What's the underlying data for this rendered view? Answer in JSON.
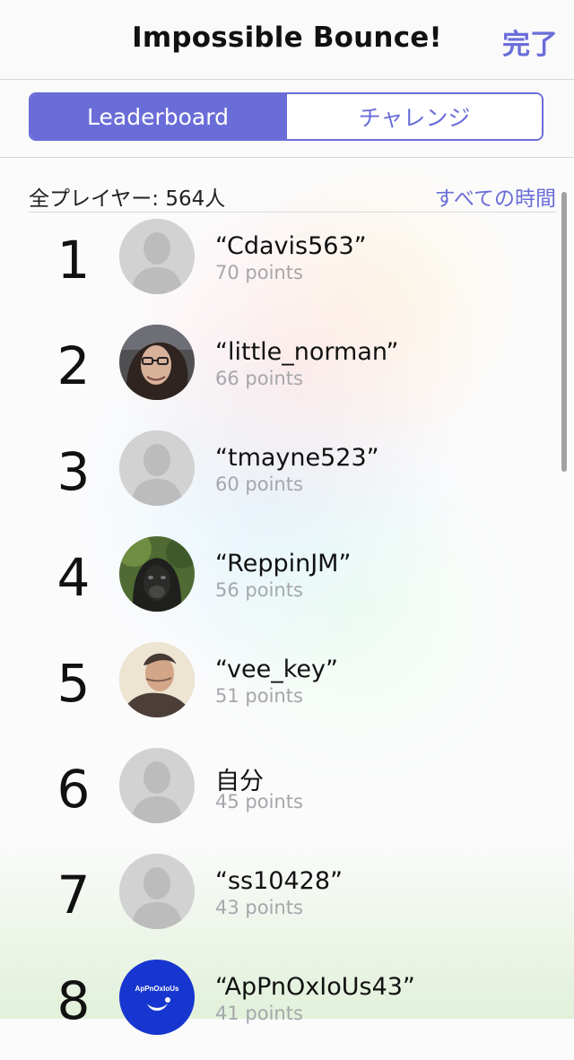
{
  "header": {
    "title": "Impossible Bounce!",
    "done_label": "完了"
  },
  "segmented": {
    "leaderboard_label": "Leaderboard",
    "challenge_label": "チャレンジ"
  },
  "summary": {
    "player_count_text": "全プレイヤー: 564人",
    "time_filter_label": "すべての時間"
  },
  "rows": [
    {
      "rank": "1",
      "name": "“Cdavis563”",
      "points": "70 points",
      "avatar": "default-avatar-icon"
    },
    {
      "rank": "2",
      "name": "“little_norman”",
      "points": "66 points",
      "avatar": "profile-photo-little-norman"
    },
    {
      "rank": "3",
      "name": "“tmayne523”",
      "points": "60 points",
      "avatar": "default-avatar-icon"
    },
    {
      "rank": "4",
      "name": "“ReppinJM”",
      "points": "56 points",
      "avatar": "profile-photo-reppinjm"
    },
    {
      "rank": "5",
      "name": "“vee_key”",
      "points": "51 points",
      "avatar": "profile-photo-vee-key"
    },
    {
      "rank": "6",
      "name": "自分",
      "points": "45 points",
      "avatar": "default-avatar-icon"
    },
    {
      "rank": "7",
      "name": "“ss10428”",
      "points": "43 points",
      "avatar": "default-avatar-icon"
    },
    {
      "rank": "8",
      "name": "“ApPnOxIoUs43”",
      "points": "41 points",
      "avatar": "profile-logo-appnoxious",
      "avatar_text": "ApPnOxIoUs"
    }
  ],
  "colors": {
    "accent": "#6a6dd8",
    "secondary_text": "#a6a6ab",
    "divider": "#d7d7dc"
  }
}
